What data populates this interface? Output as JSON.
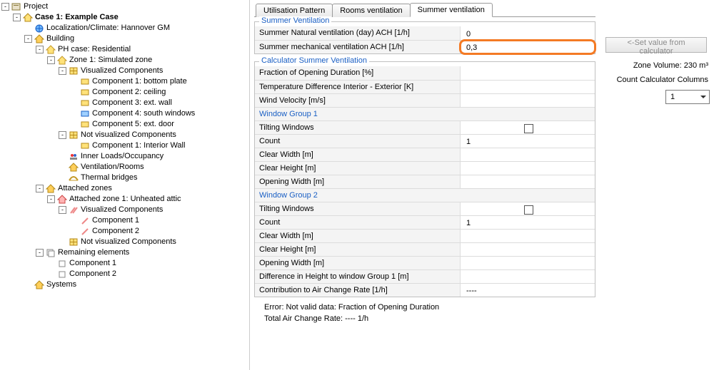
{
  "tree": {
    "root": "Project",
    "items": [
      {
        "indent": 0,
        "toggle": "-",
        "icon": "project",
        "label": "Project"
      },
      {
        "indent": 1,
        "toggle": "-",
        "icon": "case",
        "label": "Case 1: Example Case",
        "bold": true
      },
      {
        "indent": 2,
        "toggle": "",
        "icon": "globe",
        "label": "Localization/Climate: Hannover GM"
      },
      {
        "indent": 2,
        "toggle": "-",
        "icon": "house",
        "label": "Building"
      },
      {
        "indent": 3,
        "toggle": "-",
        "icon": "house-y",
        "label": "PH case: Residential"
      },
      {
        "indent": 4,
        "toggle": "-",
        "icon": "house-y",
        "label": "Zone 1: Simulated zone"
      },
      {
        "indent": 5,
        "toggle": "-",
        "icon": "grid",
        "label": "Visualized Components"
      },
      {
        "indent": 6,
        "toggle": "",
        "icon": "comp-y",
        "label": "Component 1: bottom plate"
      },
      {
        "indent": 6,
        "toggle": "",
        "icon": "comp-y",
        "label": "Component 2: ceiling"
      },
      {
        "indent": 6,
        "toggle": "",
        "icon": "comp-y",
        "label": "Component 3: ext. wall"
      },
      {
        "indent": 6,
        "toggle": "",
        "icon": "comp-b",
        "label": "Component 4: south windows"
      },
      {
        "indent": 6,
        "toggle": "",
        "icon": "comp-y",
        "label": "Component 5: ext. door"
      },
      {
        "indent": 5,
        "toggle": "-",
        "icon": "grid",
        "label": "Not visualized Components"
      },
      {
        "indent": 6,
        "toggle": "",
        "icon": "comp-y",
        "label": "Component 1: Interior Wall"
      },
      {
        "indent": 5,
        "toggle": "",
        "icon": "people",
        "label": "Inner Loads/Occupancy"
      },
      {
        "indent": 5,
        "toggle": "",
        "icon": "house",
        "label": "Ventilation/Rooms"
      },
      {
        "indent": 5,
        "toggle": "",
        "icon": "bridge",
        "label": "Thermal bridges"
      },
      {
        "indent": 3,
        "toggle": "-",
        "icon": "house",
        "label": "Attached zones"
      },
      {
        "indent": 4,
        "toggle": "-",
        "icon": "house-r",
        "label": "Attached zone 1: Unheated attic"
      },
      {
        "indent": 5,
        "toggle": "-",
        "icon": "pencils",
        "label": "Visualized Components"
      },
      {
        "indent": 6,
        "toggle": "",
        "icon": "pencil",
        "label": "Component 1"
      },
      {
        "indent": 6,
        "toggle": "",
        "icon": "pencil",
        "label": "Component 2"
      },
      {
        "indent": 5,
        "toggle": "",
        "icon": "grid",
        "label": "Not visualized Components"
      },
      {
        "indent": 3,
        "toggle": "-",
        "icon": "layers",
        "label": "Remaining elements"
      },
      {
        "indent": 4,
        "toggle": "",
        "icon": "layer",
        "label": "Component 1"
      },
      {
        "indent": 4,
        "toggle": "",
        "icon": "layer",
        "label": "Component 2"
      },
      {
        "indent": 2,
        "toggle": "",
        "icon": "house",
        "label": "Systems"
      }
    ]
  },
  "tabs": {
    "items": [
      "Utilisation Pattern",
      "Rooms ventilation",
      "Summer ventilation"
    ],
    "active": 2
  },
  "summer_vent": {
    "group_title": "Summer Ventilation",
    "rows": [
      {
        "label": "Summer Natural ventilation (day) ACH  [1/h]",
        "value": "0",
        "highlight": false
      },
      {
        "label": "Summer mechanical ventilation ACH  [1/h]",
        "value": "0,3",
        "highlight": true
      }
    ]
  },
  "calc": {
    "group_title": "Calculator Summer Ventilation",
    "rows": [
      {
        "type": "text",
        "label": "Fraction of Opening Duration  [%]",
        "value": ""
      },
      {
        "type": "text",
        "label": "Temperature Difference Interior - Exterior  [K]",
        "value": ""
      },
      {
        "type": "text",
        "label": "Wind Velocity  [m/s]",
        "value": ""
      },
      {
        "type": "head",
        "label": "Window Group 1"
      },
      {
        "type": "check",
        "label": "Tilting Windows",
        "value": false
      },
      {
        "type": "text",
        "label": "Count",
        "value": "1"
      },
      {
        "type": "text",
        "label": "Clear Width  [m]",
        "value": ""
      },
      {
        "type": "text",
        "label": "Clear Height  [m]",
        "value": ""
      },
      {
        "type": "text",
        "label": "Opening Width  [m]",
        "value": ""
      },
      {
        "type": "head",
        "label": "Window Group 2"
      },
      {
        "type": "check",
        "label": "Tilting Windows",
        "value": false
      },
      {
        "type": "text",
        "label": "Count",
        "value": "1"
      },
      {
        "type": "text",
        "label": "Clear Width  [m]",
        "value": ""
      },
      {
        "type": "text",
        "label": "Clear Height  [m]",
        "value": ""
      },
      {
        "type": "text",
        "label": "Opening Width  [m]",
        "value": ""
      },
      {
        "type": "text",
        "label": "Difference in Height to window Group 1  [m]",
        "value": ""
      },
      {
        "type": "text",
        "label": "Contribution to Air Change Rate  [1/h]",
        "value": "----"
      }
    ]
  },
  "footer": {
    "line1": "Error: Not valid data: Fraction of Opening Duration",
    "line2": "Total Air Change Rate: ----   1/h"
  },
  "side": {
    "btn": "<-Set value from calculator",
    "zone_volume_label": "Zone Volume: 230 m³",
    "count_cols_label": "Count Calculator Columns",
    "count_cols_value": "1"
  }
}
